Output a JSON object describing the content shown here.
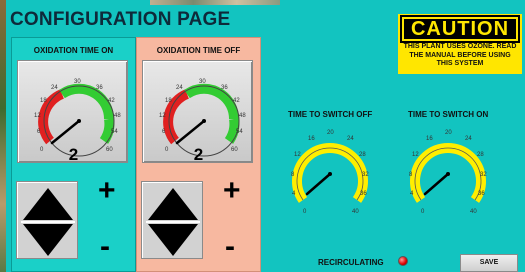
{
  "page_title": "CONFIGURATION PAGE",
  "caution": {
    "heading": "CAUTION",
    "line1": "THIS PLANT USES OZONE. READ",
    "line2": "THE MANUAL BEFORE USING",
    "line3": "THIS SYSTEM"
  },
  "oxidation_on": {
    "title": "OXIDATION TIME ON",
    "value": "2",
    "ticks": [
      "0",
      "6",
      "12",
      "18",
      "24",
      "30",
      "36",
      "42",
      "48",
      "54",
      "60"
    ],
    "plus": "+",
    "minus": "-"
  },
  "oxidation_off": {
    "title": "OXIDATION TIME OFF",
    "value": "2",
    "ticks": [
      "0",
      "6",
      "12",
      "18",
      "24",
      "30",
      "36",
      "42",
      "48",
      "54",
      "60"
    ],
    "plus": "+",
    "minus": "-"
  },
  "switch_off": {
    "title": "TIME TO SWITCH OFF",
    "ticks": [
      "0",
      "4",
      "8",
      "12",
      "16",
      "20",
      "24",
      "28",
      "32",
      "36",
      "40"
    ]
  },
  "switch_on": {
    "title": "TIME TO SWITCH ON",
    "ticks": [
      "0",
      "4",
      "8",
      "12",
      "16",
      "20",
      "24",
      "28",
      "32",
      "36",
      "40"
    ]
  },
  "status": {
    "recirculating_label": "RECIRCULATING",
    "led_color": "#e00000"
  },
  "save_label": "SAVE",
  "colors": {
    "background": "#12c4c0",
    "panel_on": "#1ad0c8",
    "panel_off": "#f7b8a0",
    "gauge_red": "#e02020",
    "gauge_green": "#33cc33",
    "gauge_yellow": "#ffee00"
  }
}
